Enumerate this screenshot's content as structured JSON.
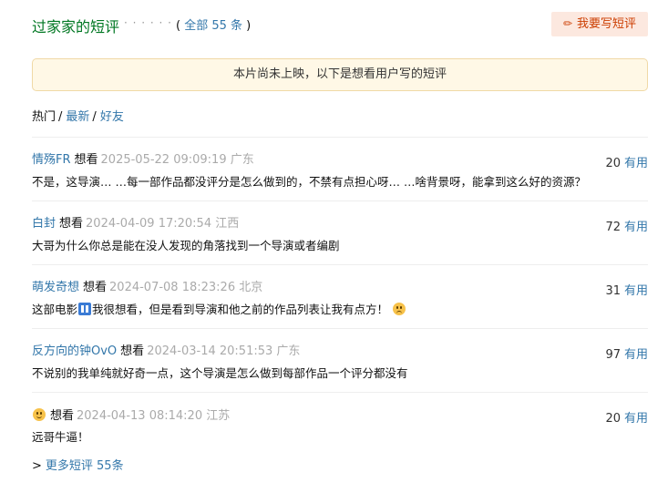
{
  "header": {
    "title": "过家家的短评",
    "dots": "· · · · · ·",
    "count_open": "(",
    "count_text": "全部 55 条",
    "count_close": ")",
    "write_button": "我要写短评"
  },
  "notice": "本片尚未上映，以下是想看用户写的短评",
  "tabs": {
    "hot": "热门",
    "sep": "/",
    "latest": "最新",
    "friends": "好友"
  },
  "comments": [
    {
      "user": "情殇FR",
      "rating": "想看",
      "time": "2025-05-22 09:09:19 广东",
      "votes": "20",
      "useful": "有用",
      "content": "不是，这导演… …每一部作品都没评分是怎么做到的，不禁有点担心呀… …啥背景呀，能拿到这么好的资源？"
    },
    {
      "user": "白封",
      "rating": "想看",
      "time": "2024-04-09 17:20:54 江西",
      "votes": "72",
      "useful": "有用",
      "content": "大哥为什么你总是能在没人发现的角落找到一个导演或者编剧"
    },
    {
      "user": "萌发奇想",
      "rating": "想看",
      "time": "2024-07-08 18:23:26 北京",
      "votes": "31",
      "useful": "有用",
      "content_a": "这部电影",
      "content_b": "我很想看，但是看到导演和他之前的作品列表让我有点方！"
    },
    {
      "user": "反方向的钟OvO",
      "rating": "想看",
      "time": "2024-03-14 20:51:53 广东",
      "votes": "97",
      "useful": "有用",
      "content": "不说别的我单纯就好奇一点，这个导演是怎么做到每部作品一个评分都没有"
    },
    {
      "rating": "想看",
      "time": "2024-04-13 08:14:20 江苏",
      "votes": "20",
      "useful": "有用",
      "content": "远哥牛逼！"
    }
  ],
  "more": {
    "arrow": ">",
    "label": "更多短评 55条"
  }
}
